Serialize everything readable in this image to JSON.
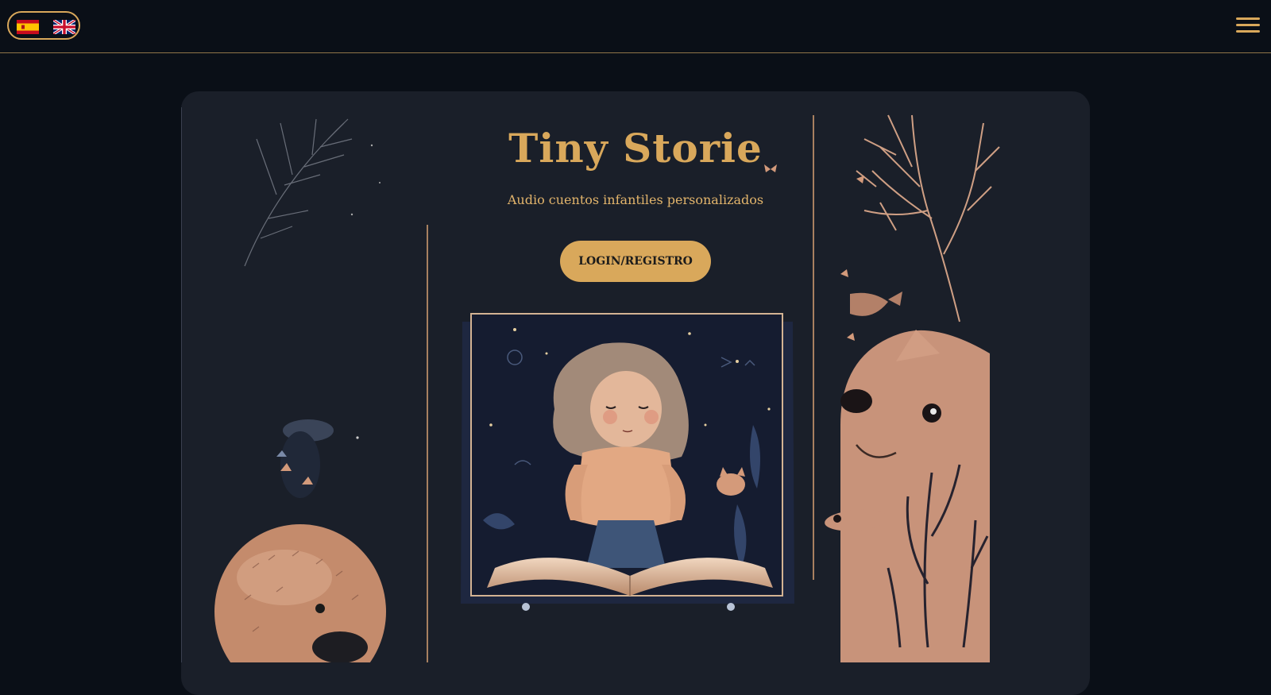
{
  "header": {
    "languages": [
      {
        "code": "es",
        "name": "Español"
      },
      {
        "code": "en",
        "name": "English"
      }
    ],
    "menu_icon": "hamburger-icon"
  },
  "hero": {
    "title": "Tiny Storie",
    "subtitle": "Audio cuentos infantiles personalizados",
    "cta_label": "LOGIN/REGISTRO"
  },
  "colors": {
    "background": "#0a0f17",
    "card": "#1a1f29",
    "accent": "#d9a85b",
    "illustration_warm": "#d39a7b",
    "illustration_dark": "#151c30"
  }
}
